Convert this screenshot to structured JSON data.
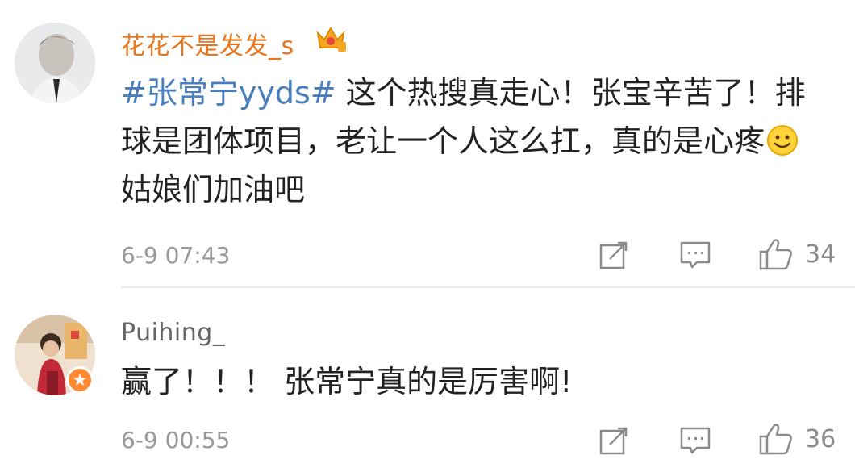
{
  "comments": [
    {
      "username": "花花不是发发_s",
      "username_color": "#e8751a",
      "hashtag": "#张常宁yyds#",
      "text": " 这个热搜真走心！张宝辛苦了！排球是团体项目，老让一个人这么扛，真的是心疼",
      "text_after_emoji": "姑娘们加油吧",
      "emoji": "smile-emoji",
      "badge": "crown-badge",
      "time": "6-9 07:43",
      "likes": "34"
    },
    {
      "username": "Puihing_",
      "username_color": "#666666",
      "text": "赢了！！！ 张常宁真的是厉害啊!",
      "badge": "verified-badge",
      "time": "6-9 00:55",
      "likes": "36"
    }
  ],
  "icons": {
    "share": "share-icon",
    "comment": "comment-icon",
    "like": "thumbs-up-icon"
  },
  "colors": {
    "hashtag": "#4a7fbf",
    "meta": "#999999",
    "divider": "#e8e8e8"
  }
}
